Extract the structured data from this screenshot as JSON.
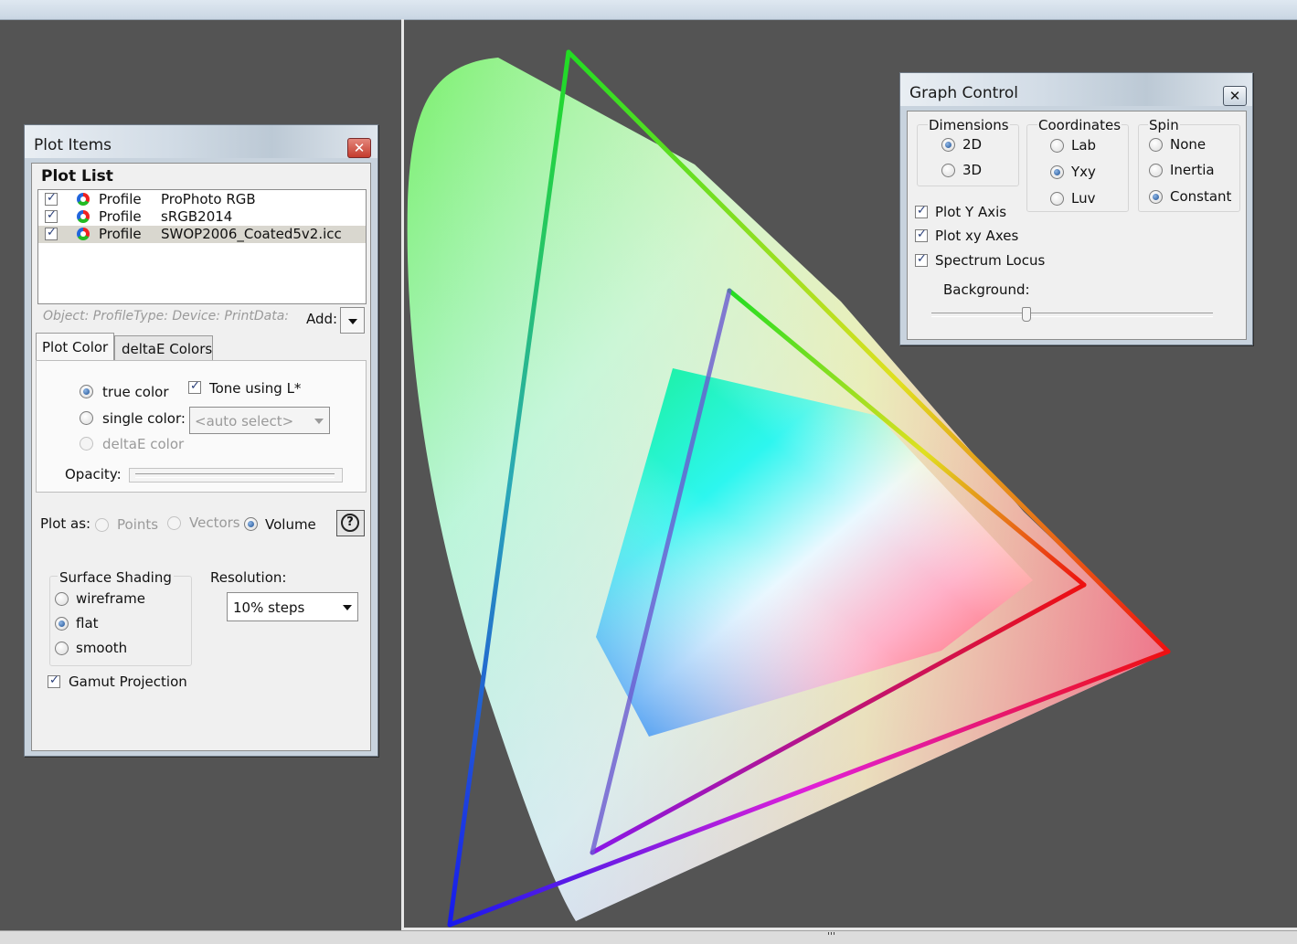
{
  "plot_items": {
    "title": "Plot Items",
    "plot_list_header": "Plot List",
    "profiles": [
      {
        "type": "Profile",
        "name": "ProPhoto RGB",
        "checked": true
      },
      {
        "type": "Profile",
        "name": "sRGB2014",
        "checked": true
      },
      {
        "type": "Profile",
        "name": "SWOP2006_Coated5v2.icc",
        "checked": true
      }
    ],
    "object_filter": "Object: ProfileType: Device: PrintData: ",
    "add_label": "Add:",
    "tabs": [
      "Plot Color",
      "deltaE Colors"
    ],
    "true_color": "true color",
    "tone_using": "Tone using L*",
    "single_color": "single color:",
    "auto_select": "<auto select>",
    "deltae_color": "deltaE color",
    "opacity": "Opacity:",
    "plot_as": "Plot as:",
    "points": "Points",
    "vectors": "Vectors",
    "volume": "Volume",
    "help": "?",
    "surface_shading": "Surface Shading",
    "wireframe": "wireframe",
    "flat": "flat",
    "smooth": "smooth",
    "resolution": "Resolution:",
    "resolution_value": "10% steps",
    "gamut_projection": "Gamut Projection"
  },
  "graph_control": {
    "title": "Graph Control",
    "dimensions": "Dimensions",
    "dim_2d": "2D",
    "dim_3d": "3D",
    "coordinates": "Coordinates",
    "lab": "Lab",
    "yxy": "Yxy",
    "luv": "Luv",
    "spin": "Spin",
    "none": "None",
    "inertia": "Inertia",
    "constant": "Constant",
    "plot_y_axis": "Plot Y Axis",
    "plot_xy_axes": "Plot xy Axes",
    "spectrum_locus": "Spectrum Locus",
    "background": "Background:"
  },
  "colors": {
    "canvas_background": "#545454",
    "prophoto_gamut": "triangle green-red-blue",
    "srgb_gamut": "triangle green-red-violet"
  },
  "status": {
    "grip": "'''"
  }
}
